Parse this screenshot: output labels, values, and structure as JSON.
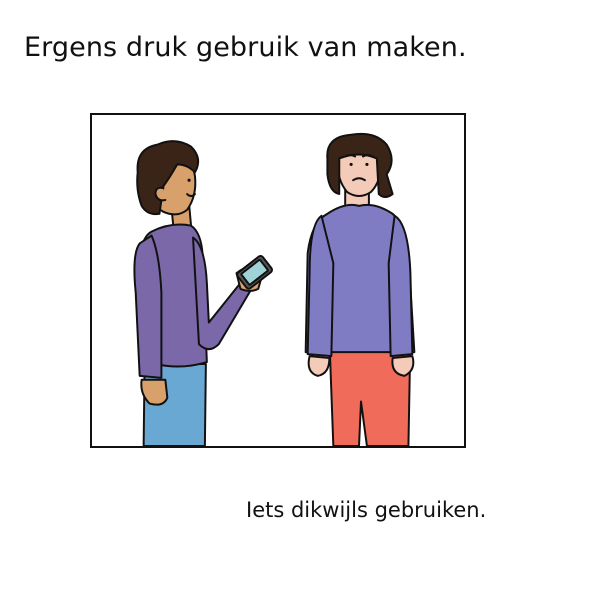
{
  "heading": "Ergens druk gebruik van maken.",
  "caption": "Iets dikwijls gebruiken.",
  "colors": {
    "outline": "#111111",
    "hair": "#3a2418",
    "skin_left": "#d8a06a",
    "skin_right": "#f4cab8",
    "sweater_left": "#7a68a8",
    "sweater_right": "#7f7cc4",
    "pants_left": "#6aa8d4",
    "pants_right": "#f16b5b",
    "phone_screen": "#9ed4d8"
  }
}
